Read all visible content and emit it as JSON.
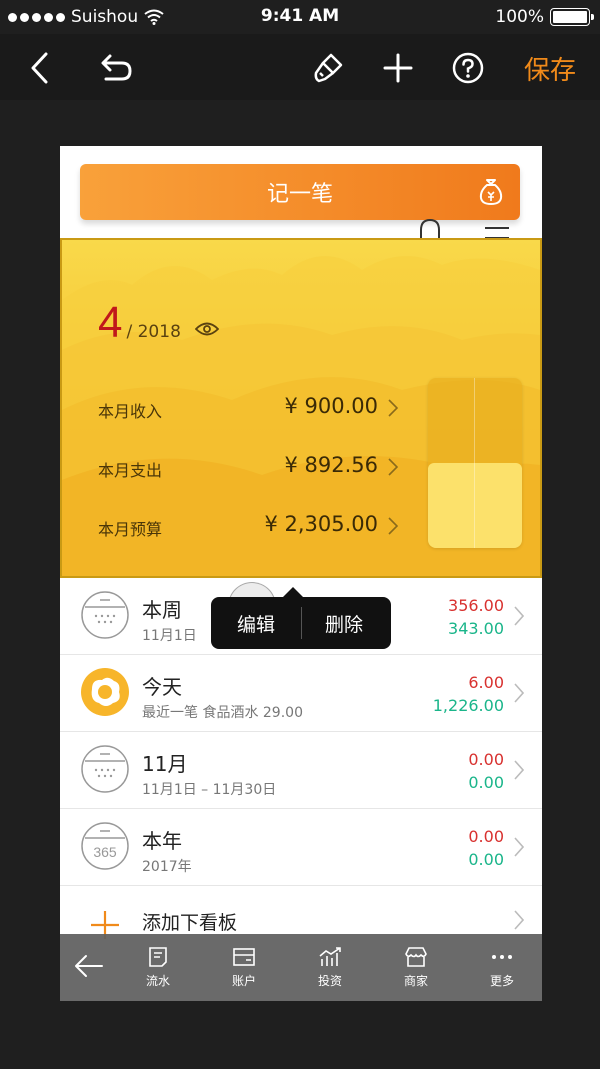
{
  "status_bar": {
    "carrier": "Suishou",
    "time": "9:41 AM",
    "battery": "100%"
  },
  "toolbar": {
    "save_label": "保存"
  },
  "preview": {
    "record_button": "记一笔",
    "summary": {
      "month": "4",
      "year": "/ 2018",
      "income_label": "本月收入",
      "income_value": "¥ 900.00",
      "expense_label": "本月支出",
      "expense_value": "¥ 892.56",
      "budget_label": "本月预算",
      "budget_value": "¥ 2,305.00",
      "budget_used_fraction": 0.5
    },
    "items": [
      {
        "title": "本周",
        "sub": "11月1日",
        "v1": "356.00",
        "v2": "343.00",
        "icon": "calendar-icon"
      },
      {
        "title": "今天",
        "sub": "最近一笔 食品酒水 29.00",
        "v1": "6.00",
        "v2": "1,226.00",
        "icon": "egg-icon"
      },
      {
        "title": "11月",
        "sub": "11月1日 – 11月30日",
        "v1": "0.00",
        "v2": "0.00",
        "icon": "calendar-icon"
      },
      {
        "title": "本年",
        "sub": "2017年",
        "v1": "0.00",
        "v2": "0.00",
        "icon": "calendar-365-icon",
        "icon_text": "365"
      }
    ],
    "add_board": "添加下看板",
    "bottom_nav": [
      {
        "label": "流水",
        "icon": "document-icon"
      },
      {
        "label": "账户",
        "icon": "card-icon"
      },
      {
        "label": "投资",
        "icon": "chart-icon"
      },
      {
        "label": "商家",
        "icon": "store-icon"
      },
      {
        "label": "更多",
        "icon": "more-icon"
      }
    ]
  },
  "popup": {
    "edit": "编辑",
    "delete": "删除"
  },
  "colors": {
    "accent": "#f08a1a",
    "income_red": "#d8312f",
    "expense_green": "#1ab58a",
    "card_yellow": "#f6c22f"
  }
}
